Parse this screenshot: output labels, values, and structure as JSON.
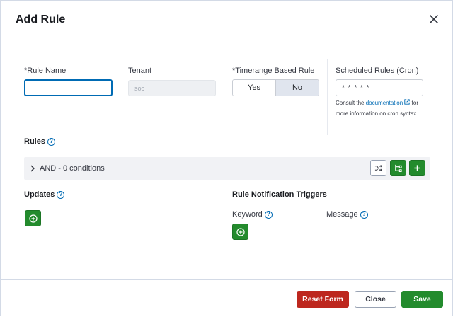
{
  "modal": {
    "title": "Add Rule",
    "close_label": "Close dialog"
  },
  "fields": {
    "rule_name": {
      "label": "Rule Name",
      "required": "*",
      "value": ""
    },
    "tenant": {
      "label": "Tenant",
      "value": "soc"
    },
    "timerange": {
      "label": "Timerange Based Rule",
      "required": "*",
      "options": [
        "Yes",
        "No"
      ],
      "selected": "No"
    },
    "cron": {
      "label": "Scheduled Rules (Cron)",
      "value": "* * * * *",
      "hint_prefix": "Consult the ",
      "hint_link": "documentation",
      "hint_suffix": " for more information on cron syntax."
    }
  },
  "rules": {
    "label": "Rules",
    "condition_text": "AND - 0 conditions"
  },
  "updates": {
    "label": "Updates"
  },
  "notifications": {
    "label": "Rule Notification Triggers",
    "keyword_label": "Keyword",
    "message_label": "Message"
  },
  "footer": {
    "reset_label": "Reset Form",
    "close_label": "Close",
    "save_label": "Save"
  },
  "colors": {
    "accent_blue": "#006bb4",
    "primary_green": "#238b2d",
    "danger_red": "#bd271e",
    "segment_selected": "#e0e5ee"
  }
}
